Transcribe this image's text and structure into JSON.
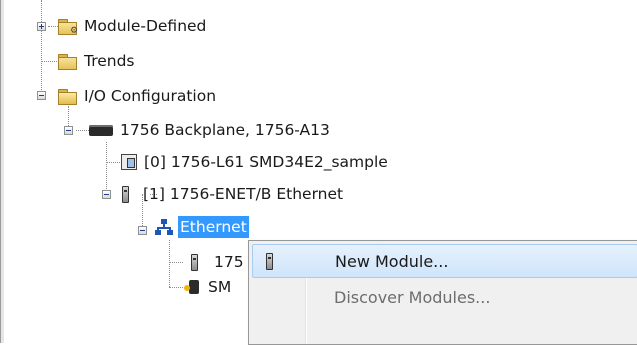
{
  "tree": {
    "module_defined": "Module-Defined",
    "trends": "Trends",
    "io_configuration": "I/O Configuration",
    "backplane": "1756 Backplane, 1756-A13",
    "controller": "[0] 1756-L61 SMD34E2_sample",
    "enet_module": "[1] 1756-ENET/B Ethernet",
    "ethernet": "Ethernet",
    "child_module": "175",
    "child_drive": "SM"
  },
  "context_menu": {
    "items": [
      {
        "label": "New Module...",
        "icon": "module-icon",
        "enabled": true
      },
      {
        "label": "Discover Modules...",
        "enabled": false
      }
    ]
  },
  "colors": {
    "selection": "#3399ff",
    "menu_highlight": "#cfe5fb",
    "menu_bg": "#f0f0f0"
  }
}
